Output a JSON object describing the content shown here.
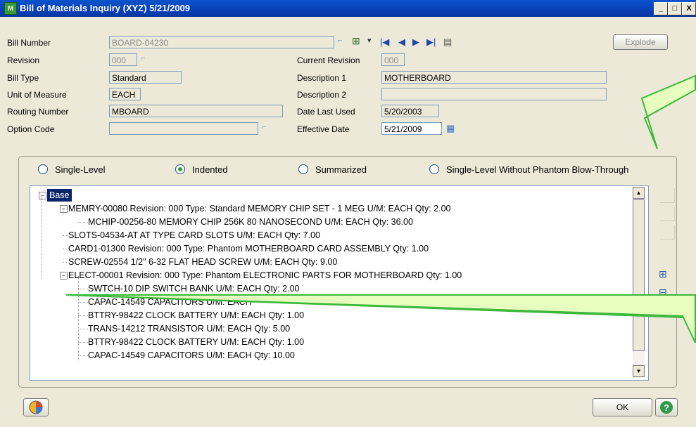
{
  "window": {
    "title": "Bill of Materials Inquiry (XYZ) 5/21/2009",
    "minimize": "_",
    "maximize": "□",
    "close": "X"
  },
  "fields": {
    "bill_number": {
      "label": "Bill Number",
      "value": "BOARD-04230"
    },
    "revision": {
      "label": "Revision",
      "value": "000"
    },
    "bill_type": {
      "label": "Bill Type",
      "value": "Standard"
    },
    "unit_of_measure": {
      "label": "Unit of Measure",
      "value": "EACH"
    },
    "routing_number": {
      "label": "Routing Number",
      "value": "MBOARD"
    },
    "option_code": {
      "label": "Option Code",
      "value": ""
    },
    "current_revision": {
      "label": "Current Revision",
      "value": "000"
    },
    "description_1": {
      "label": "Description 1",
      "value": "MOTHERBOARD"
    },
    "description_2": {
      "label": "Description 2",
      "value": ""
    },
    "date_last_used": {
      "label": "Date Last Used",
      "value": "5/20/2003"
    },
    "effective_date": {
      "label": "Effective Date",
      "value": "5/21/2009"
    }
  },
  "buttons": {
    "explode": "Explode",
    "ok": "OK"
  },
  "radio_options": [
    {
      "label": "Single-Level",
      "selected": false
    },
    {
      "label": "Indented",
      "selected": true
    },
    {
      "label": "Summarized",
      "selected": false
    },
    {
      "label": "Single-Level Without Phantom Blow-Through",
      "selected": false
    }
  ],
  "tree": [
    {
      "text": "Base",
      "level": 0,
      "toggle": "−",
      "selected": true
    },
    {
      "text": "MEMRY-00080   Revision: 000   Type: Standard   MEMORY CHIP SET - 1 MEG     U/M: EACH     Qty: 2.00",
      "level": 1,
      "toggle": "−"
    },
    {
      "text": "MCHIP-00256-80   MEMORY CHIP 256K 80 NANOSECOND    U/M: EACH    Qty: 36.00",
      "level": 2,
      "toggle": ""
    },
    {
      "text": "SLOTS-04534-AT    AT TYPE CARD SLOTS    U/M: EACH    Qty: 7.00",
      "level": 1,
      "toggle": ""
    },
    {
      "text": "CARD1-01300    Revision: 000   Type: Phantom    MOTHERBOARD CARD ASSEMBLY     Qty: 1.00",
      "level": 1,
      "toggle": ""
    },
    {
      "text": "SCREW-02554    1/2\" 6-32 FLAT HEAD SCREW    U/M: EACH    Qty: 9.00",
      "level": 1,
      "toggle": ""
    },
    {
      "text": "ELECT-00001    Revision: 000   Type: Phantom    ELECTRONIC PARTS FOR MOTHERBOARD     Qty: 1.00",
      "level": 1,
      "toggle": "−"
    },
    {
      "text": "SWTCH-10     DIP SWITCH BANK    U/M: EACH    Qty: 2.00",
      "level": 2,
      "toggle": ""
    },
    {
      "text": "CAPAC-14549    CAPACITORS    U/M: EACH",
      "level": 2,
      "toggle": ""
    },
    {
      "text": "BTTRY-98422    CLOCK BATTERY    U/M: EACH    Qty: 1.00",
      "level": 2,
      "toggle": ""
    },
    {
      "text": "TRANS-14212    TRANSISTOR    U/M: EACH    Qty: 5.00",
      "level": 2,
      "toggle": ""
    },
    {
      "text": "BTTRY-98422    CLOCK BATTERY    U/M: EACH    Qty: 1.00",
      "level": 2,
      "toggle": ""
    },
    {
      "text": "CAPAC-14549    CAPACITORS    U/M: EACH    Qty: 10.00",
      "level": 2,
      "toggle": ""
    }
  ],
  "colors": {
    "callout_fill": "#e6ffbe",
    "callout_stroke": "#3cb83c",
    "selection": "#0a246a"
  }
}
